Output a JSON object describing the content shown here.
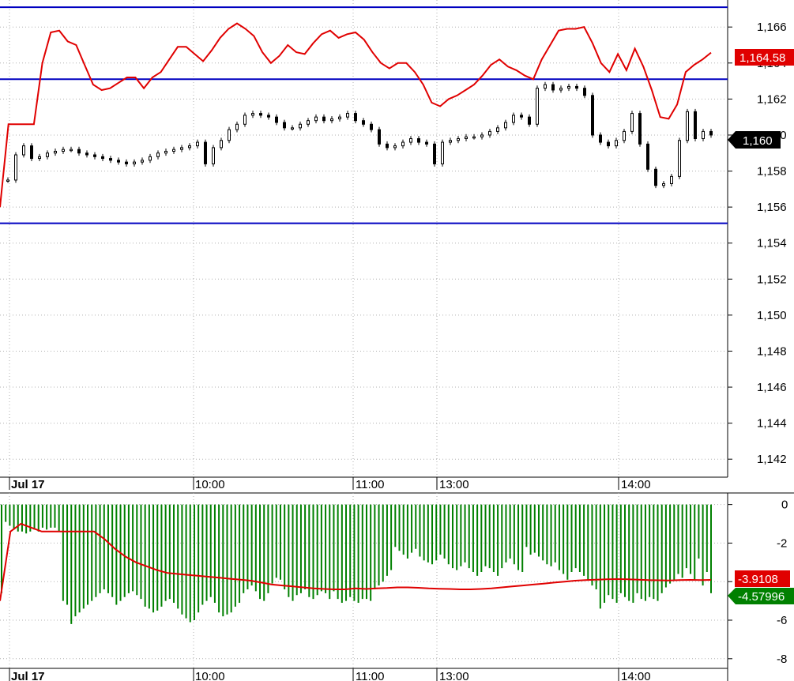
{
  "chart_data": [
    {
      "type": "candlestick",
      "title": "",
      "ylim": [
        1141,
        1167.5
      ],
      "y_ticks": [
        "1,142",
        "1,144",
        "1,146",
        "1,148",
        "1,150",
        "1,152",
        "1,154",
        "1,156",
        "1,158",
        "1,160",
        "1,162",
        "1,164",
        "1,166"
      ],
      "x_labels": [
        "Jul 17",
        "10:00",
        "11:00",
        "13:00",
        "14:00"
      ],
      "horizontal_lines": [
        1167.1,
        1163.1,
        1155.1
      ],
      "colors": {
        "candles": "#000000",
        "overlay": "#e00000",
        "hlines": "#0000c0",
        "grid": "#b0b0b0"
      },
      "last_price_label": "1,160",
      "overlay_last_label": "1,164.58",
      "close_series": [
        1157.5,
        1158.9,
        1159.4,
        1158.7,
        1158.8,
        1159.0,
        1159.1,
        1159.2,
        1159.2,
        1159.0,
        1158.9,
        1158.8,
        1158.7,
        1158.6,
        1158.5,
        1158.4,
        1158.5,
        1158.6,
        1158.8,
        1159.0,
        1159.1,
        1159.2,
        1159.3,
        1159.4,
        1159.6,
        1158.4,
        1159.3,
        1159.7,
        1160.3,
        1160.6,
        1161.1,
        1161.2,
        1161.1,
        1161.0,
        1160.7,
        1160.4,
        1160.4,
        1160.6,
        1160.8,
        1161.0,
        1160.8,
        1160.9,
        1161.0,
        1161.2,
        1160.8,
        1160.6,
        1160.3,
        1159.5,
        1159.3,
        1159.4,
        1159.6,
        1159.8,
        1159.6,
        1159.5,
        1158.4,
        1159.6,
        1159.7,
        1159.8,
        1159.9,
        1159.9,
        1160.0,
        1160.2,
        1160.4,
        1160.7,
        1161.1,
        1161.0,
        1160.6,
        1162.6,
        1162.8,
        1162.5,
        1162.6,
        1162.7,
        1162.6,
        1162.2,
        1160.0,
        1159.6,
        1159.4,
        1159.7,
        1160.2,
        1161.2,
        1159.5,
        1158.1,
        1157.2,
        1157.3,
        1157.7,
        1159.7,
        1161.3,
        1159.8,
        1160.2,
        1160.0
      ],
      "overlay_series": [
        1156.0,
        1160.6,
        1160.6,
        1160.6,
        1160.6,
        1164.0,
        1165.7,
        1165.8,
        1165.2,
        1165.0,
        1163.9,
        1162.8,
        1162.5,
        1162.6,
        1162.9,
        1163.2,
        1163.2,
        1162.6,
        1163.2,
        1163.5,
        1164.2,
        1164.9,
        1164.9,
        1164.5,
        1164.1,
        1164.7,
        1165.4,
        1165.9,
        1166.2,
        1165.9,
        1165.5,
        1164.6,
        1164.0,
        1164.4,
        1165.0,
        1164.6,
        1164.5,
        1165.1,
        1165.6,
        1165.8,
        1165.4,
        1165.6,
        1165.7,
        1165.3,
        1164.6,
        1164.0,
        1163.7,
        1164.0,
        1164.0,
        1163.5,
        1162.8,
        1161.8,
        1161.6,
        1162.0,
        1162.2,
        1162.5,
        1162.8,
        1163.3,
        1163.9,
        1164.2,
        1163.8,
        1163.6,
        1163.3,
        1163.1,
        1164.2,
        1165.0,
        1165.8,
        1165.9,
        1165.9,
        1166.0,
        1165.1,
        1164.0,
        1163.5,
        1164.5,
        1163.6,
        1164.8,
        1163.8,
        1162.5,
        1161.0,
        1160.9,
        1161.7,
        1163.5,
        1163.9,
        1164.2,
        1164.58
      ],
      "xlabel": "",
      "ylabel": ""
    },
    {
      "type": "bar",
      "title": "",
      "ylim": [
        -8.5,
        0.6
      ],
      "y_ticks": [
        "0",
        "-2",
        "-4",
        "-6",
        "-8"
      ],
      "x_labels": [
        "Jul 17",
        "10:00",
        "11:00",
        "13:00",
        "14:00"
      ],
      "colors": {
        "bars": "#008000",
        "line": "#e00000"
      },
      "bar_flag_label": "-4.57996",
      "line_flag_label": "-3.9108",
      "bar_values": [
        -4.6,
        -0.9,
        -1.1,
        -1.3,
        -1.4,
        -1.4,
        -1.5,
        -1.4,
        -1.3,
        -1.4,
        -1.2,
        -1.3,
        -1.2,
        -1.2,
        -1.4,
        -5.0,
        -5.2,
        -6.2,
        -5.8,
        -5.6,
        -5.4,
        -5.2,
        -5.0,
        -4.8,
        -4.6,
        -4.4,
        -4.6,
        -4.8,
        -5.2,
        -5.0,
        -4.8,
        -4.6,
        -4.5,
        -4.7,
        -4.9,
        -5.3,
        -5.4,
        -5.6,
        -5.5,
        -5.3,
        -5.0,
        -4.9,
        -5.1,
        -5.4,
        -5.7,
        -5.9,
        -6.1,
        -6.0,
        -5.6,
        -5.2,
        -5.0,
        -4.8,
        -5.1,
        -5.6,
        -5.8,
        -5.7,
        -5.6,
        -5.3,
        -5.1,
        -4.6,
        -4.4,
        -4.2,
        -4.5,
        -4.9,
        -5.0,
        -4.6,
        -4.1,
        -3.8,
        -3.9,
        -4.4,
        -4.8,
        -5.0,
        -4.7,
        -4.6,
        -4.4,
        -4.8,
        -4.9,
        -4.7,
        -4.5,
        -4.6,
        -4.9,
        -4.5,
        -4.9,
        -5.1,
        -5.0,
        -4.8,
        -5.0,
        -5.1,
        -4.9,
        -4.9,
        -5.0,
        -4.4,
        -4.2,
        -4.0,
        -3.7,
        -3.4,
        -2.2,
        -2.4,
        -2.6,
        -2.8,
        -2.5,
        -2.3,
        -2.7,
        -2.9,
        -3.0,
        -3.1,
        -2.9,
        -2.6,
        -2.8,
        -3.1,
        -3.3,
        -3.4,
        -3.2,
        -3.0,
        -3.3,
        -3.5,
        -3.7,
        -3.5,
        -3.2,
        -3.3,
        -3.5,
        -3.7,
        -3.3,
        -3.0,
        -2.8,
        -3.1,
        -3.4,
        -3.5,
        -2.2,
        -2.6,
        -2.5,
        -2.7,
        -2.9,
        -3.1,
        -3.2,
        -3.0,
        -3.4,
        -3.6,
        -3.9,
        -3.5,
        -3.3,
        -3.5,
        -3.7,
        -3.9,
        -4.2,
        -4.4,
        -5.4,
        -5.1,
        -4.7,
        -4.9,
        -5.1,
        -4.6,
        -4.8,
        -5.0,
        -5.1,
        -4.6,
        -4.9,
        -5.0,
        -4.8,
        -4.9,
        -5.0,
        -4.6,
        -4.3,
        -4.1,
        -3.9,
        -3.6,
        -3.8,
        -3.3,
        -3.6,
        -3.9,
        -2.8,
        -4.2,
        -3.5,
        -4.6
      ],
      "line_values": [
        -5.0,
        -1.4,
        -1.0,
        -1.2,
        -1.4,
        -1.4,
        -1.4,
        -1.4,
        -1.4,
        -1.4,
        -1.8,
        -2.3,
        -2.7,
        -3.0,
        -3.2,
        -3.4,
        -3.55,
        -3.6,
        -3.65,
        -3.7,
        -3.75,
        -3.8,
        -3.85,
        -3.9,
        -3.95,
        -4.05,
        -4.15,
        -4.2,
        -4.25,
        -4.3,
        -4.35,
        -4.38,
        -4.4,
        -4.4,
        -4.35,
        -4.38,
        -4.35,
        -4.33,
        -4.3,
        -4.3,
        -4.32,
        -4.35,
        -4.37,
        -4.38,
        -4.4,
        -4.4,
        -4.38,
        -4.35,
        -4.3,
        -4.25,
        -4.2,
        -4.15,
        -4.1,
        -4.05,
        -4.0,
        -3.95,
        -3.92,
        -3.9,
        -3.88,
        -3.87,
        -3.88,
        -3.9,
        -3.92,
        -3.93,
        -3.94,
        -3.92,
        -3.91,
        -3.92,
        -3.91
      ],
      "xlabel": "",
      "ylabel": ""
    }
  ]
}
